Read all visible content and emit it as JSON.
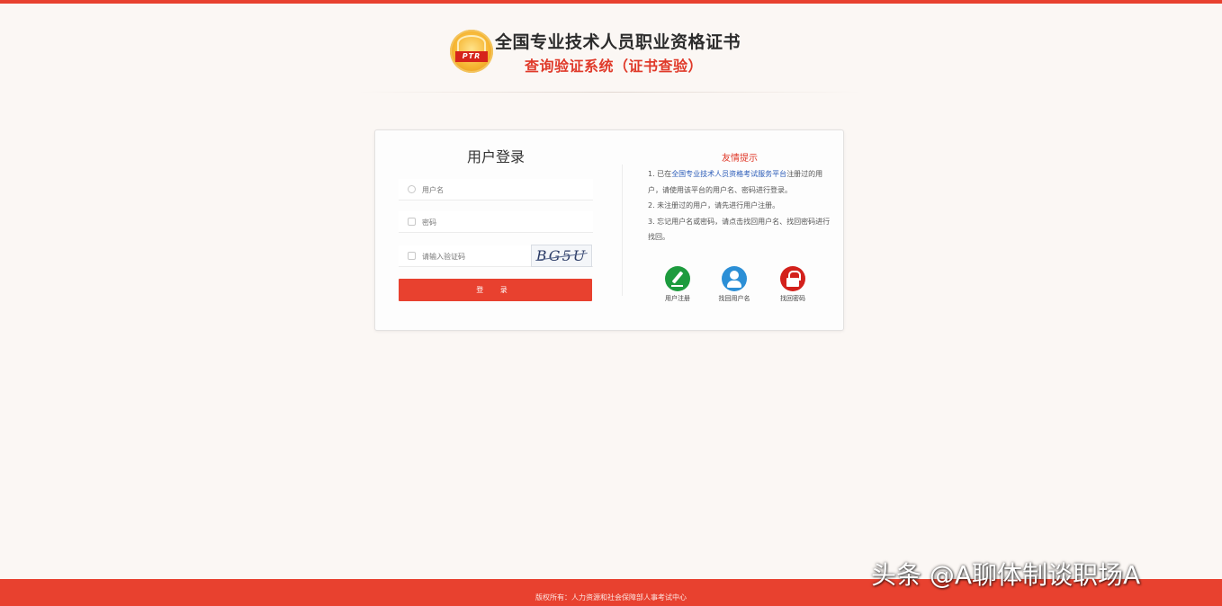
{
  "header": {
    "logo_text": "PTR",
    "title": "全国专业技术人员职业资格证书",
    "subtitle": "查询验证系统（证书查验）"
  },
  "login": {
    "title": "用户登录",
    "username_placeholder": "用户名",
    "password_placeholder": "密码",
    "captcha_placeholder": "请输入验证码",
    "captcha_code": "BG5U",
    "submit_label": "登 录"
  },
  "tips": {
    "title": "友情提示",
    "line1_prefix": "1. 已在",
    "line1_link": "全国专业技术人员资格考试服务平台",
    "line1_suffix": "注册过的用户，请使用该平台的用户名、密码进行登录。",
    "line2": "2. 未注册过的用户，请先进行用户注册。",
    "line3": "3. 忘记用户名或密码，请点击找回用户名、找回密码进行找回。"
  },
  "actions": [
    {
      "icon": "pencil-icon",
      "label": "用户注册",
      "color": "#1d9b3e"
    },
    {
      "icon": "user-icon",
      "label": "找回用户名",
      "color": "#2c8fd6"
    },
    {
      "icon": "lock-icon",
      "label": "找回密码",
      "color": "#d3211c"
    }
  ],
  "footer": {
    "text": "版权所有：人力资源和社会保障部人事考试中心"
  },
  "watermark": "头条 @A聊体制谈职场A",
  "colors": {
    "accent": "#e8412f",
    "title_red": "#e03a2a",
    "background": "#fbf7f4",
    "link": "#2a5bb8"
  }
}
